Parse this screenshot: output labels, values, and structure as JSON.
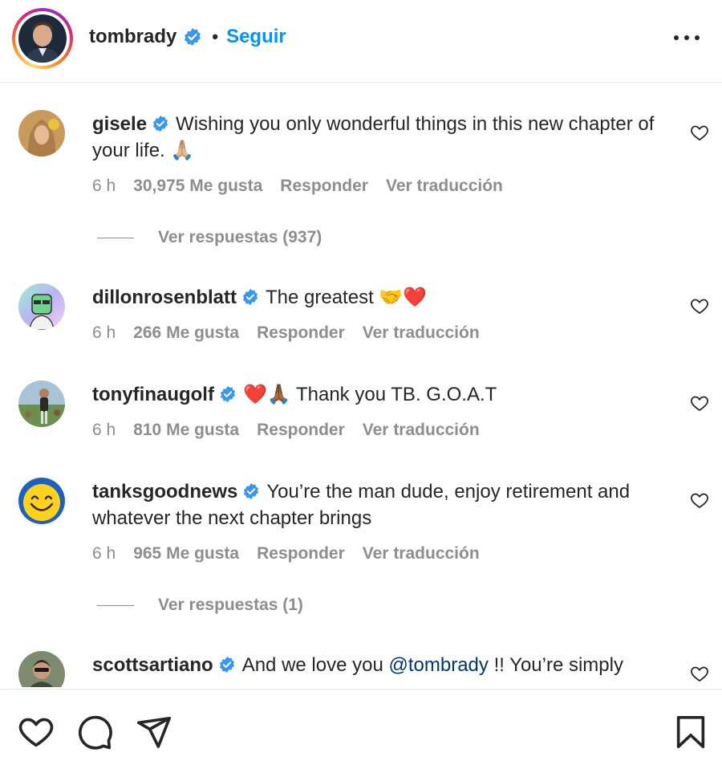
{
  "post_header": {
    "username": "tombrady",
    "separator": "•",
    "follow_label": "Seguir"
  },
  "comments": [
    {
      "username": "gisele",
      "text": "Wishing you only wonderful things in this new chapter of your life. 🙏🏼",
      "time": "6 h",
      "likes": "30,975 Me gusta",
      "reply": "Responder",
      "translate": "Ver traducción",
      "view_replies": "Ver respuestas (937)"
    },
    {
      "username": "dillonrosenblatt",
      "text": "The greatest 🤝❤️",
      "time": "6 h",
      "likes": "266 Me gusta",
      "reply": "Responder",
      "translate": "Ver traducción"
    },
    {
      "username": "tonyfinaugolf",
      "text": "❤️🙏🏾 Thank you TB. G.O.A.T",
      "time": "6 h",
      "likes": "810 Me gusta",
      "reply": "Responder",
      "translate": "Ver traducción"
    },
    {
      "username": "tanksgoodnews",
      "text": "You’re the man dude, enjoy retirement and whatever the next chapter brings",
      "time": "6 h",
      "likes": "965 Me gusta",
      "reply": "Responder",
      "translate": "Ver traducción",
      "view_replies": "Ver respuestas (1)"
    },
    {
      "username": "scottsartiano",
      "text_before": "And we love you",
      "mention": "@tombrady",
      "text_after": "!! You’re simply"
    }
  ],
  "icons": {
    "verified": "verified-badge-icon",
    "more": "more-options-icon",
    "comment_like": "heart-outline-icon",
    "like": "heart-icon",
    "comment": "comment-bubble-icon",
    "share": "paper-plane-icon",
    "save": "bookmark-icon"
  },
  "colors": {
    "accent": "#0095f6",
    "verified": "#3897f0",
    "text": "#262626",
    "secondary_text": "#8e8e8e",
    "mention": "#00376b",
    "divider": "#e6e6e6"
  }
}
